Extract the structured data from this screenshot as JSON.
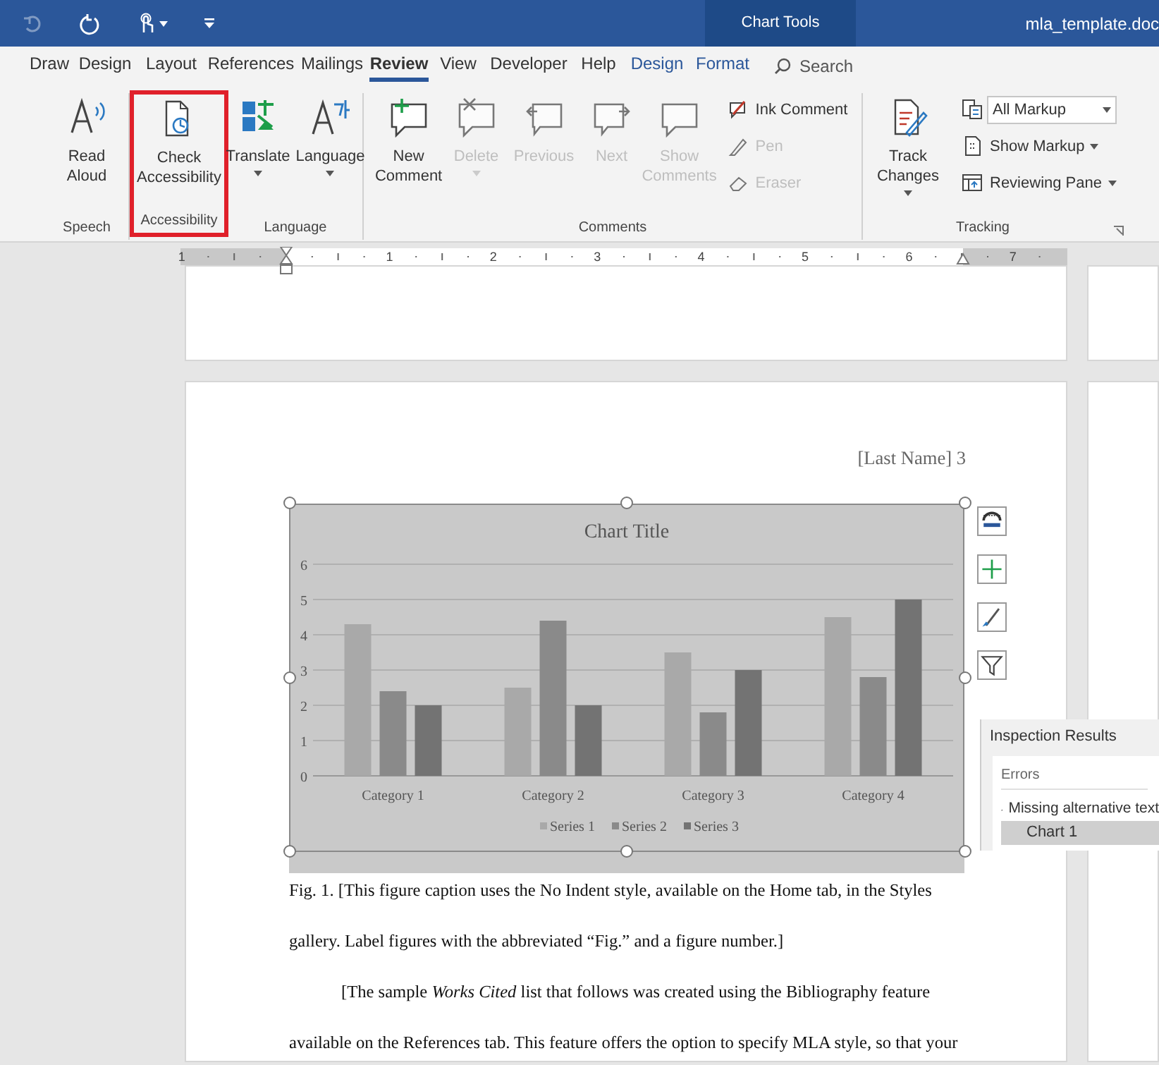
{
  "title_bar": {
    "contextual_label": "Chart Tools",
    "document_title": "mla_template.doc"
  },
  "tabs": [
    {
      "label": "Draw",
      "selected": false,
      "contextual": false
    },
    {
      "label": "Design",
      "selected": false,
      "contextual": false
    },
    {
      "label": "Layout",
      "selected": false,
      "contextual": false
    },
    {
      "label": "References",
      "selected": false,
      "contextual": false
    },
    {
      "label": "Mailings",
      "selected": false,
      "contextual": false
    },
    {
      "label": "Review",
      "selected": true,
      "contextual": false
    },
    {
      "label": "View",
      "selected": false,
      "contextual": false
    },
    {
      "label": "Developer",
      "selected": false,
      "contextual": false
    },
    {
      "label": "Help",
      "selected": false,
      "contextual": false
    },
    {
      "label": "Design",
      "selected": false,
      "contextual": true
    },
    {
      "label": "Format",
      "selected": false,
      "contextual": true
    }
  ],
  "search": {
    "placeholder": "Search"
  },
  "ribbon_groups": [
    {
      "label": "Speech",
      "highlighted": false,
      "items": [
        {
          "kind": "large",
          "label": "Read Aloud",
          "disabled": false,
          "has_menu": false
        }
      ]
    },
    {
      "label": "Accessibility",
      "highlighted": true,
      "items": [
        {
          "kind": "large",
          "label": "Check Accessibility",
          "disabled": false,
          "has_menu": false
        }
      ]
    },
    {
      "label": "Language",
      "highlighted": false,
      "items": [
        {
          "kind": "large",
          "label": "Translate",
          "disabled": false,
          "has_menu": true
        },
        {
          "kind": "large",
          "label": "Language",
          "disabled": false,
          "has_menu": true
        }
      ]
    },
    {
      "label": "Comments",
      "highlighted": false,
      "items": [
        {
          "kind": "large",
          "label": "New Comment",
          "disabled": false,
          "has_menu": false
        },
        {
          "kind": "large",
          "label": "Delete",
          "disabled": true,
          "has_menu": true
        },
        {
          "kind": "large",
          "label": "Previous",
          "disabled": true,
          "has_menu": false
        },
        {
          "kind": "large",
          "label": "Next",
          "disabled": true,
          "has_menu": false
        },
        {
          "kind": "large",
          "label": "Show Comments",
          "disabled": true,
          "has_menu": false
        },
        {
          "kind": "stack",
          "items": [
            {
              "kind": "small",
              "label": "Ink Comment",
              "disabled": false,
              "has_menu": false
            },
            {
              "kind": "small",
              "label": "Pen",
              "disabled": true,
              "has_menu": false
            },
            {
              "kind": "small",
              "label": "Eraser",
              "disabled": true,
              "has_menu": false
            }
          ]
        }
      ]
    },
    {
      "label": "Tracking",
      "highlighted": false,
      "items": [
        {
          "kind": "large",
          "label": "Track Changes",
          "disabled": false,
          "has_menu": true
        },
        {
          "kind": "stack",
          "items": [
            {
              "kind": "dropdown",
              "label": "All Markup",
              "disabled": false,
              "has_menu": true
            },
            {
              "kind": "small",
              "label": "Show Markup",
              "disabled": false,
              "has_menu": true
            },
            {
              "kind": "small",
              "label": "Reviewing Pane",
              "disabled": false,
              "has_menu": true
            }
          ]
        }
      ]
    }
  ],
  "ruler": {
    "marks": [
      "1",
      "1",
      "2",
      "3",
      "4",
      "5",
      "6",
      "7"
    ]
  },
  "page": {
    "header": "[Last Name] 3",
    "chart": {
      "chart_data": {
        "type": "bar",
        "title": "Chart Title",
        "categories": [
          "Category 1",
          "Category 2",
          "Category 3",
          "Category 4"
        ],
        "series": [
          {
            "name": "Series 1",
            "color": "#a9a9a9",
            "values": [
              4.3,
              2.5,
              3.5,
              4.5
            ]
          },
          {
            "name": "Series 2",
            "color": "#8a8a8a",
            "values": [
              2.4,
              4.4,
              1.8,
              2.8
            ]
          },
          {
            "name": "Series 3",
            "color": "#737373",
            "values": [
              2,
              2,
              3,
              5
            ]
          }
        ],
        "ylim": [
          0,
          6
        ],
        "yticks": [
          0,
          1,
          2,
          3,
          4,
          5,
          6
        ],
        "legend": "bottom"
      }
    },
    "paragraphs": [
      {
        "text": "Fig. 1. [This figure caption uses the No Indent style, available on the Home tab, in the Styles gallery. Label figures with the abbreviated “Fig.” and a figure number.]",
        "indented": false
      },
      {
        "text": "[The sample *Works Cited* list that follows was created using the Bibliography feature available on the References tab. This feature offers the option to specify MLA style, so that your",
        "indented": true
      }
    ]
  },
  "inspection_pane": {
    "title": "Inspection Results",
    "section": "Errors",
    "issue": {
      "label": "Missing alternative text",
      "expanded": true,
      "items": [
        {
          "label": "Chart 1",
          "selected": true
        }
      ]
    }
  }
}
